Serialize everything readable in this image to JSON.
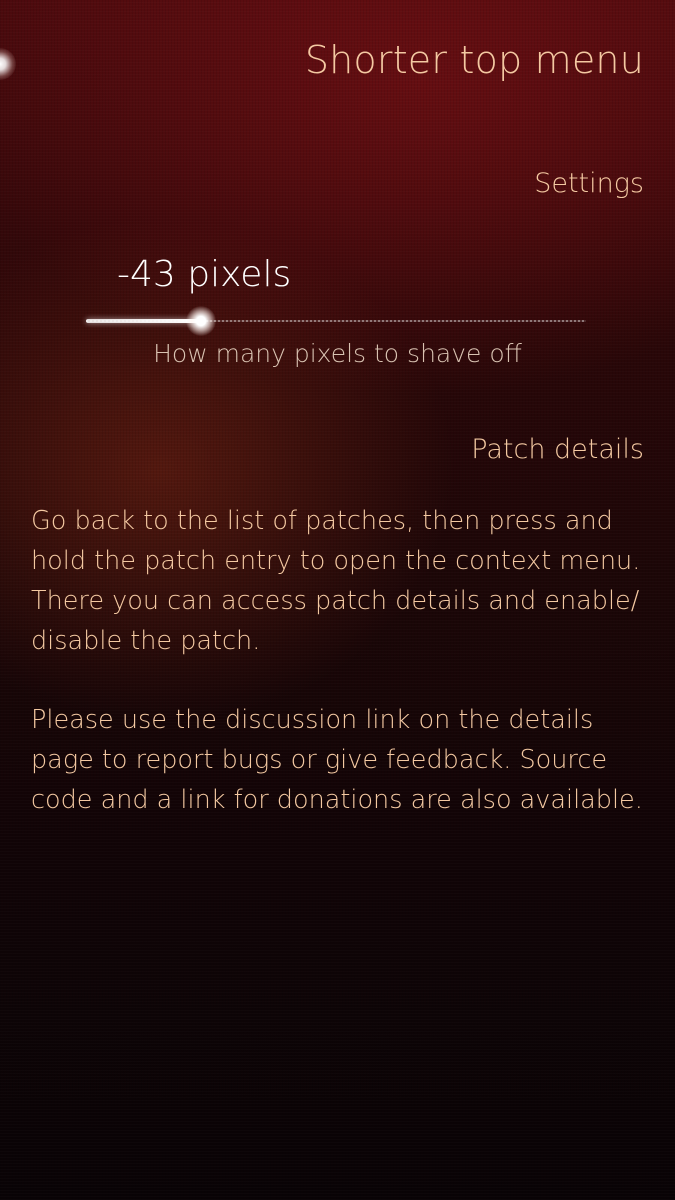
{
  "header": {
    "title": "Shorter top menu"
  },
  "settings": {
    "section_title": "Settings",
    "slider": {
      "value_text": "-43 pixels",
      "label": "How many pixels to shave off",
      "fraction": 0.23
    }
  },
  "details": {
    "section_title": "Patch details",
    "paragraph_1": "Go back to the list of patches, then press and hold the patch entry to open the context menu. There you can access patch details and enable/ disable the patch.",
    "paragraph_2": "Please use the discussion link on the details page to report bugs or give feedback. Source code and a link for donations are also available."
  },
  "colors": {
    "accent_text": "#f4c9a2",
    "slider_value": "#ffffff",
    "secondary_text": "#d9c3b2"
  }
}
